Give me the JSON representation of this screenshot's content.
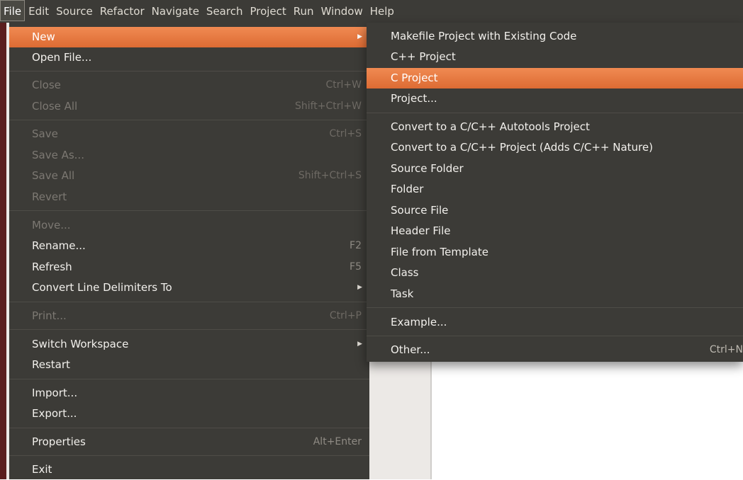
{
  "menubar": [
    "File",
    "Edit",
    "Source",
    "Refactor",
    "Navigate",
    "Search",
    "Project",
    "Run",
    "Window",
    "Help"
  ],
  "file_menu": {
    "new": "New",
    "open_file": "Open File...",
    "close": "Close",
    "close_accel": "Ctrl+W",
    "close_all": "Close All",
    "close_all_accel": "Shift+Ctrl+W",
    "save": "Save",
    "save_accel": "Ctrl+S",
    "save_as": "Save As...",
    "save_all": "Save All",
    "save_all_accel": "Shift+Ctrl+S",
    "revert": "Revert",
    "move": "Move...",
    "rename": "Rename...",
    "rename_accel": "F2",
    "refresh": "Refresh",
    "refresh_accel": "F5",
    "convert_line_delimiters": "Convert Line Delimiters To",
    "print": "Print...",
    "print_accel": "Ctrl+P",
    "switch_workspace": "Switch Workspace",
    "restart": "Restart",
    "import": "Import...",
    "export": "Export...",
    "properties": "Properties",
    "properties_accel": "Alt+Enter",
    "exit": "Exit"
  },
  "new_menu": {
    "makefile_project": "Makefile Project with Existing Code",
    "cpp_project": "C++ Project",
    "c_project": "C Project",
    "project": "Project...",
    "convert_autotools": "Convert to a C/C++ Autotools Project",
    "convert_cpp": "Convert to a C/C++ Project (Adds C/C++ Nature)",
    "source_folder": "Source Folder",
    "folder": "Folder",
    "source_file": "Source File",
    "header_file": "Header File",
    "file_from_template": "File from Template",
    "class": "Class",
    "task": "Task",
    "example": "Example...",
    "other": "Other...",
    "other_accel": "Ctrl+N"
  },
  "colors": {
    "menu_bg": "#3c3b37",
    "highlight": "#e9773f",
    "disabled_text": "#7c7872"
  },
  "icons": {
    "submenu_arrow": "triangle-right-icon"
  }
}
